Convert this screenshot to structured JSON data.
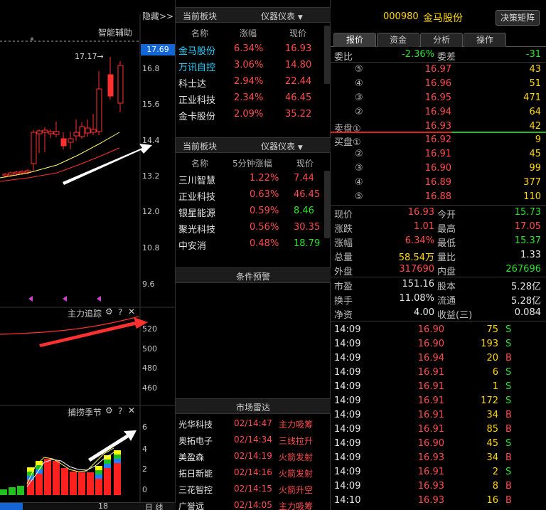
{
  "chart": {
    "hide_btn": "隐藏>>",
    "assist_label": "智能辅助",
    "price_tag": "17.69",
    "high_annot": "17.17→",
    "price_ticks": [
      "16.8",
      "15.6",
      "14.4",
      "13.2",
      "12.0",
      "10.8",
      "9.6"
    ],
    "ind1_title": "主力追踪",
    "ind1_ticks": [
      "520",
      "500",
      "480",
      "460"
    ],
    "ind2_title": "捕捞季节",
    "ind2_ticks": [
      "6",
      "4",
      "2",
      "0"
    ],
    "bottom_text": "18",
    "bottom_right": "日 线"
  },
  "sector1": {
    "title": "当前板块",
    "menu": "仪器仪表",
    "headers": [
      "名称",
      "涨幅",
      "现价"
    ],
    "rows": [
      {
        "name": "金马股份",
        "chg": "6.34%",
        "price": "16.93",
        "hl": true
      },
      {
        "name": "万讯自控",
        "chg": "3.06%",
        "price": "14.80",
        "hl": true
      },
      {
        "name": "科士达",
        "chg": "2.94%",
        "price": "22.44",
        "hl": false
      },
      {
        "name": "正业科技",
        "chg": "2.34%",
        "price": "46.45",
        "hl": false
      },
      {
        "name": "金卡股份",
        "chg": "2.09%",
        "price": "35.22",
        "hl": false
      }
    ]
  },
  "sector2": {
    "title": "当前板块",
    "menu": "仪器仪表",
    "headers": [
      "名称",
      "5分钟涨幅",
      "现价"
    ],
    "rows": [
      {
        "name": "三川智慧",
        "chg": "1.22%",
        "price": "7.44",
        "pc": "red"
      },
      {
        "name": "正业科技",
        "chg": "0.63%",
        "price": "46.45",
        "pc": "red"
      },
      {
        "name": "银星能源",
        "chg": "0.59%",
        "price": "8.46",
        "pc": "green"
      },
      {
        "name": "聚光科技",
        "chg": "0.56%",
        "price": "30.35",
        "pc": "red"
      },
      {
        "name": "中安消",
        "chg": "0.48%",
        "price": "18.79",
        "pc": "green"
      }
    ]
  },
  "alert": {
    "title": "条件预警"
  },
  "radar": {
    "title": "市场雷达",
    "rows": [
      {
        "name": "光华科技",
        "time": "02/14:47",
        "event": "主力吸筹"
      },
      {
        "name": "奥拓电子",
        "time": "02/14:34",
        "event": "三线拉升"
      },
      {
        "name": "美盈森",
        "time": "02/14:19",
        "event": "火箭发射"
      },
      {
        "name": "拓日新能",
        "time": "02/14:16",
        "event": "火箭发射"
      },
      {
        "name": "三花智控",
        "time": "02/14:15",
        "event": "火箭升空"
      },
      {
        "name": "广誉远",
        "time": "02/14:05",
        "event": "主力吸筹"
      }
    ]
  },
  "quote": {
    "code": "000980",
    "name": "金马股份",
    "decision_btn": "决策矩阵",
    "tabs": [
      "报价",
      "资金",
      "分析",
      "操作"
    ],
    "weibi_label": "委比",
    "weibi": "-2.36%",
    "weicha_label": "委差",
    "weicha": "-31",
    "asks": [
      {
        "lvl": "⑤",
        "price": "16.97",
        "vol": "43"
      },
      {
        "lvl": "④",
        "price": "16.96",
        "vol": "51"
      },
      {
        "lvl": "③",
        "price": "16.95",
        "vol": "471"
      },
      {
        "lvl": "②",
        "price": "16.94",
        "vol": "64"
      },
      {
        "lvl": "卖盘①",
        "price": "16.93",
        "vol": "42"
      }
    ],
    "bids": [
      {
        "lvl": "买盘①",
        "price": "16.92",
        "vol": "9"
      },
      {
        "lvl": "②",
        "price": "16.91",
        "vol": "45"
      },
      {
        "lvl": "③",
        "price": "16.90",
        "vol": "99"
      },
      {
        "lvl": "④",
        "price": "16.89",
        "vol": "377"
      },
      {
        "lvl": "⑤",
        "price": "16.88",
        "vol": "110"
      }
    ],
    "stats": [
      {
        "l1": "现价",
        "v1": "16.93",
        "c1": "red",
        "l2": "今开",
        "v2": "15.73",
        "c2": "green"
      },
      {
        "l1": "涨跌",
        "v1": "1.01",
        "c1": "red",
        "l2": "最高",
        "v2": "17.05",
        "c2": "red"
      },
      {
        "l1": "涨幅",
        "v1": "6.34%",
        "c1": "red",
        "l2": "最低",
        "v2": "15.37",
        "c2": "green"
      },
      {
        "l1": "总量",
        "v1": "58.54万",
        "c1": "yellow",
        "l2": "量比",
        "v2": "1.33",
        "c2": "white"
      },
      {
        "l1": "外盘",
        "v1": "317690",
        "c1": "red",
        "l2": "内盘",
        "v2": "267696",
        "c2": "green"
      }
    ],
    "fin": [
      {
        "l1": "市盈",
        "v1": "151.16",
        "l2": "股本",
        "v2": "5.28亿"
      },
      {
        "l1": "换手",
        "v1": "11.08%",
        "l2": "流通",
        "v2": "5.28亿"
      },
      {
        "l1": "净资",
        "v1": "4.00",
        "l2": "收益(三)",
        "v2": "0.084"
      }
    ],
    "ticks": [
      {
        "t": "14:09",
        "p": "16.90",
        "v": "75",
        "s": "S"
      },
      {
        "t": "14:09",
        "p": "16.90",
        "v": "193",
        "s": "S"
      },
      {
        "t": "14:09",
        "p": "16.94",
        "v": "20",
        "s": "B"
      },
      {
        "t": "14:09",
        "p": "16.91",
        "v": "6",
        "s": "S"
      },
      {
        "t": "14:09",
        "p": "16.91",
        "v": "1",
        "s": "S"
      },
      {
        "t": "14:09",
        "p": "16.91",
        "v": "172",
        "s": "S"
      },
      {
        "t": "14:09",
        "p": "16.91",
        "v": "34",
        "s": "B"
      },
      {
        "t": "14:09",
        "p": "16.91",
        "v": "85",
        "s": "B"
      },
      {
        "t": "14:09",
        "p": "16.90",
        "v": "45",
        "s": "S"
      },
      {
        "t": "14:09",
        "p": "16.93",
        "v": "34",
        "s": "B"
      },
      {
        "t": "14:09",
        "p": "16.91",
        "v": "2",
        "s": "S"
      },
      {
        "t": "14:09",
        "p": "16.93",
        "v": "8",
        "s": "B"
      },
      {
        "t": "14:10",
        "p": "16.93",
        "v": "16",
        "s": "B"
      }
    ]
  },
  "colors": {
    "up": "#ff4b4b",
    "down": "#2ee02e",
    "text": "#c8c8c8",
    "accent": "#27d3ff",
    "volume": "#ffd700"
  }
}
